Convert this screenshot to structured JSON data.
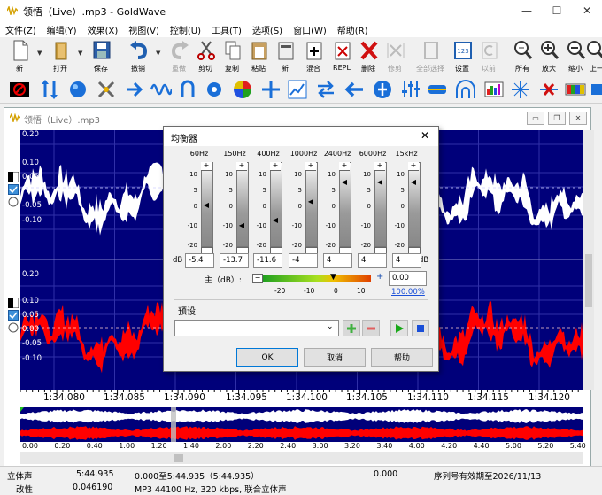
{
  "window": {
    "title": "领悟（Live）.mp3 - GoldWave",
    "min": "—",
    "max": "☐",
    "close": "✕"
  },
  "menu": [
    "文件(Z)",
    "编辑(Y)",
    "效果(X)",
    "视图(V)",
    "控制(U)",
    "工具(T)",
    "选项(S)",
    "窗口(W)",
    "帮助(R)"
  ],
  "toolbar1": [
    {
      "name": "new",
      "label": "新",
      "icon": "new-icon"
    },
    {
      "name": "open",
      "label": "打开",
      "icon": "open-icon"
    },
    {
      "name": "save",
      "label": "保存",
      "icon": "save-icon"
    },
    {
      "name": "undo",
      "label": "撤销",
      "icon": "undo-icon"
    },
    {
      "name": "redo",
      "label": "重做",
      "icon": "redo-icon"
    },
    {
      "name": "cut",
      "label": "剪切",
      "icon": "cut-icon"
    },
    {
      "name": "copy",
      "label": "复制",
      "icon": "copy-icon"
    },
    {
      "name": "paste",
      "label": "粘贴",
      "icon": "paste-icon"
    },
    {
      "name": "pastenew",
      "label": "新",
      "icon": "paste-new-icon"
    },
    {
      "name": "mix",
      "label": "混合",
      "icon": "mix-icon"
    },
    {
      "name": "repl",
      "label": "REPL",
      "icon": "replace-icon"
    },
    {
      "name": "delete",
      "label": "删除",
      "icon": "delete-icon"
    },
    {
      "name": "trim",
      "label": "修剪",
      "icon": "trim-icon"
    },
    {
      "name": "selall",
      "label": "全部选择",
      "icon": "select-all-icon"
    },
    {
      "name": "set",
      "label": "设置",
      "icon": "set-marker-icon"
    },
    {
      "name": "prev",
      "label": "以前",
      "icon": "previous-icon"
    },
    {
      "name": "all",
      "label": "所有",
      "icon": "zoom-all-icon"
    },
    {
      "name": "zoomin",
      "label": "放大",
      "icon": "zoom-in-icon"
    },
    {
      "name": "zoomout",
      "label": "缩小",
      "icon": "zoom-out-icon"
    },
    {
      "name": "up",
      "label": "上一",
      "icon": "zoom-previous-icon"
    }
  ],
  "child": {
    "title": "领悟（Live）.mp3",
    "min": "▭",
    "max": "❐",
    "close": "✕"
  },
  "wave": {
    "channel1_ticks": [
      "0.20",
      "0.10",
      "0.05",
      "0.00",
      "-0.05",
      "-0.10"
    ],
    "channel2_ticks": [
      "0.20",
      "0.10",
      "0.05",
      "0.00",
      "-0.05",
      "-0.10"
    ],
    "time_labels": [
      "1:34.080",
      "1:34.085",
      "1:34.090",
      "1:34.095",
      "1:34.100",
      "1:34.105",
      "1:34.110",
      "1:34.115",
      "1:34.120"
    ],
    "overview_labels": [
      "0:00",
      "0:20",
      "0:40",
      "1:00",
      "1:20",
      "1:40",
      "2:00",
      "2:20",
      "2:40",
      "3:00",
      "3:20",
      "3:40",
      "4:00",
      "4:20",
      "4:40",
      "5:00",
      "5:20",
      "5:40"
    ],
    "colors": {
      "background": "#00007a",
      "ch1": "#ffffff",
      "ch2": "#ff0000"
    }
  },
  "dialog": {
    "title": "均衡器",
    "close": "✕",
    "bands": [
      "60Hz",
      "150Hz",
      "400Hz",
      "1000Hz",
      "2400Hz",
      "6000Hz",
      "15kHz"
    ],
    "band_scale": [
      "10",
      "5",
      "0",
      "-10",
      "-20"
    ],
    "values": [
      "-5.4",
      "-13.7",
      "-11.6",
      "-4",
      "4",
      "4",
      "4"
    ],
    "value_levels_db": [
      -5.4,
      -13.7,
      -11.6,
      -4,
      4,
      4,
      4
    ],
    "db_label": "dB",
    "master_label": "主（dB）:",
    "master_scale": [
      "-20",
      "-10",
      "0",
      "10"
    ],
    "master_value": "0.00",
    "master_percent": "100.00%",
    "preset_label": "预设",
    "preset_value": "",
    "ok": "OK",
    "cancel": "取消",
    "help": "帮助"
  },
  "status": {
    "row1": {
      "mode": "立体声",
      "length": "5:44.935",
      "range": "0.000至5:44.935（5:44.935）",
      "pos": "0.000",
      "serial": "序列号有效期至2026/11/13"
    },
    "row2": {
      "state": "改性",
      "value": "0.046190",
      "info": "MP3 44100 Hz, 320 kbps, 联合立体声"
    }
  }
}
